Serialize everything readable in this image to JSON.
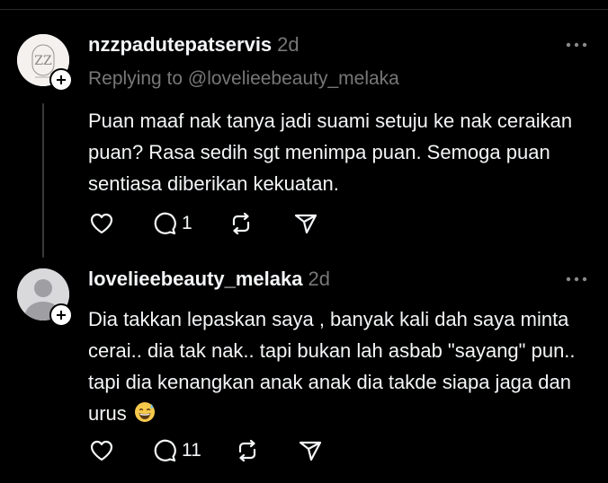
{
  "comment1": {
    "username": "nzzpadutepatservis",
    "time": "2d",
    "replying_to": "Replying to @lovelieebeauty_melaka",
    "text": "Puan maaf nak tanya jadi suami setuju ke nak ceraikan puan? Rasa sedih sgt menimpa puan. Semoga puan sentiasa diberikan kekuatan.",
    "reply_count": "1"
  },
  "comment2": {
    "username": "lovelieebeauty_melaka",
    "time": "2d",
    "text": "Dia takkan lepaskan saya , banyak kali dah saya minta cerai.. dia tak nak.. tapi bukan lah asbab \"sayang\" pun.. tapi dia kenangkan anak anak dia takde siapa jaga dan urus",
    "emoji": "grinning-face-with-sweat",
    "reply_count": "11"
  },
  "icons": {
    "like": "heart-icon",
    "reply": "comment-icon",
    "repost": "repost-icon",
    "share": "send-icon",
    "more": "more-icon",
    "follow": "plus-icon"
  },
  "colors": {
    "background": "#000000",
    "text": "#f3f5f7",
    "muted": "#777777",
    "thread_line": "#3a3a3a"
  }
}
